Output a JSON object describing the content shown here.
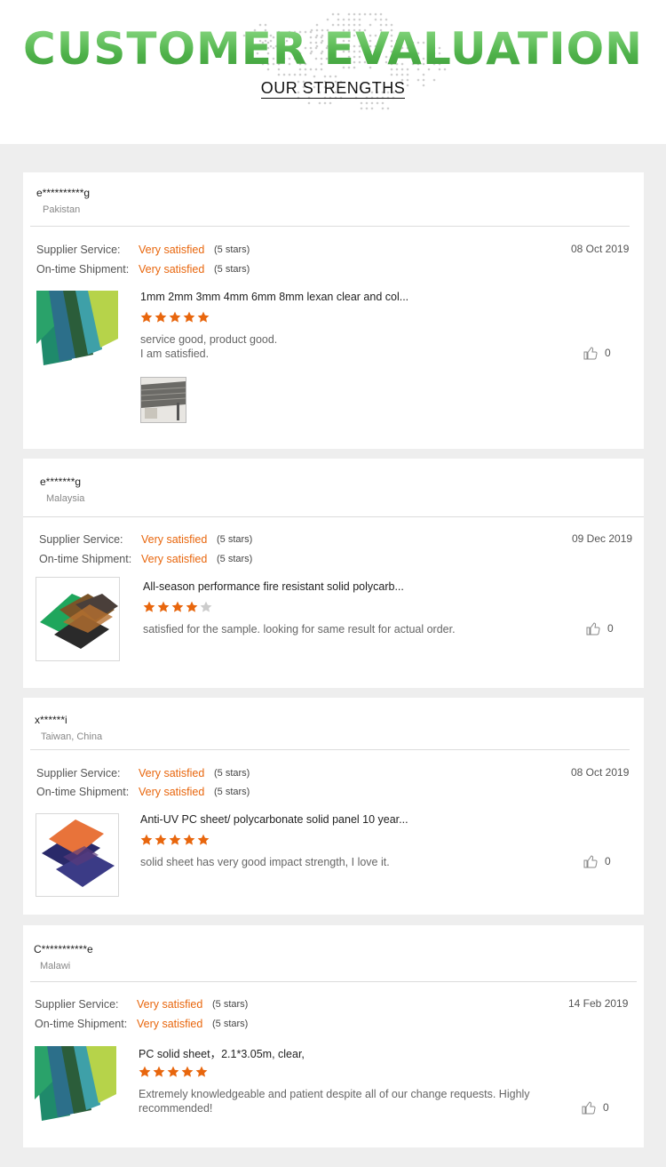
{
  "header": {
    "title": "CUSTOMER EVALUATION",
    "subtitle": "OUR STRENGTHS"
  },
  "labels": {
    "supplier_service": "Supplier Service:",
    "ontime_shipment": "On-time Shipment:"
  },
  "colors": {
    "accent": "#e8660d",
    "star_empty": "#cccccc",
    "title_green": "#5cbf58"
  },
  "reviews": [
    {
      "name": "e**********g",
      "country": "Pakistan",
      "date": "08 Oct 2019",
      "supplier_value": "Very satisfied",
      "supplier_note": "(5 stars)",
      "shipment_value": "Very satisfied",
      "shipment_note": "(5 stars)",
      "product_title": "1mm 2mm 3mm 4mm 6mm 8mm lexan clear and col...",
      "rating": 5,
      "comment": "service good, product good.\nI am satisfied.",
      "likes": "0",
      "has_attachment": true
    },
    {
      "name": "e*******g",
      "country": "Malaysia",
      "date": "09 Dec 2019",
      "supplier_value": "Very satisfied",
      "supplier_note": "(5 stars)",
      "shipment_value": "Very satisfied",
      "shipment_note": "(5 stars)",
      "product_title": "All-season performance fire resistant solid polycarb...",
      "rating": 4,
      "comment": "satisfied for the sample. looking for same result for  actual order.",
      "likes": "0",
      "has_attachment": false
    },
    {
      "name": "x******i",
      "country": "Taiwan, China",
      "date": "08 Oct 2019",
      "supplier_value": "Very satisfied",
      "supplier_note": "(5 stars)",
      "shipment_value": "Very satisfied",
      "shipment_note": "(5 stars)",
      "product_title": "Anti-UV PC sheet/ polycarbonate solid panel 10 year...",
      "rating": 5,
      "comment": "solid sheet has very good impact strength, I love it.",
      "likes": "0",
      "has_attachment": false
    },
    {
      "name": "C***********e",
      "country": "Malawi",
      "date": "14 Feb 2019",
      "supplier_value": "Very satisfied",
      "supplier_note": "(5 stars)",
      "shipment_value": "Very satisfied",
      "shipment_note": "(5 stars)",
      "product_title": "PC solid sheet，2.1*3.05m, clear,",
      "rating": 5,
      "comment": "Extremely knowledgeable and patient despite all of our change requests. Highly\nrecommended!",
      "likes": "0",
      "has_attachment": false
    }
  ]
}
